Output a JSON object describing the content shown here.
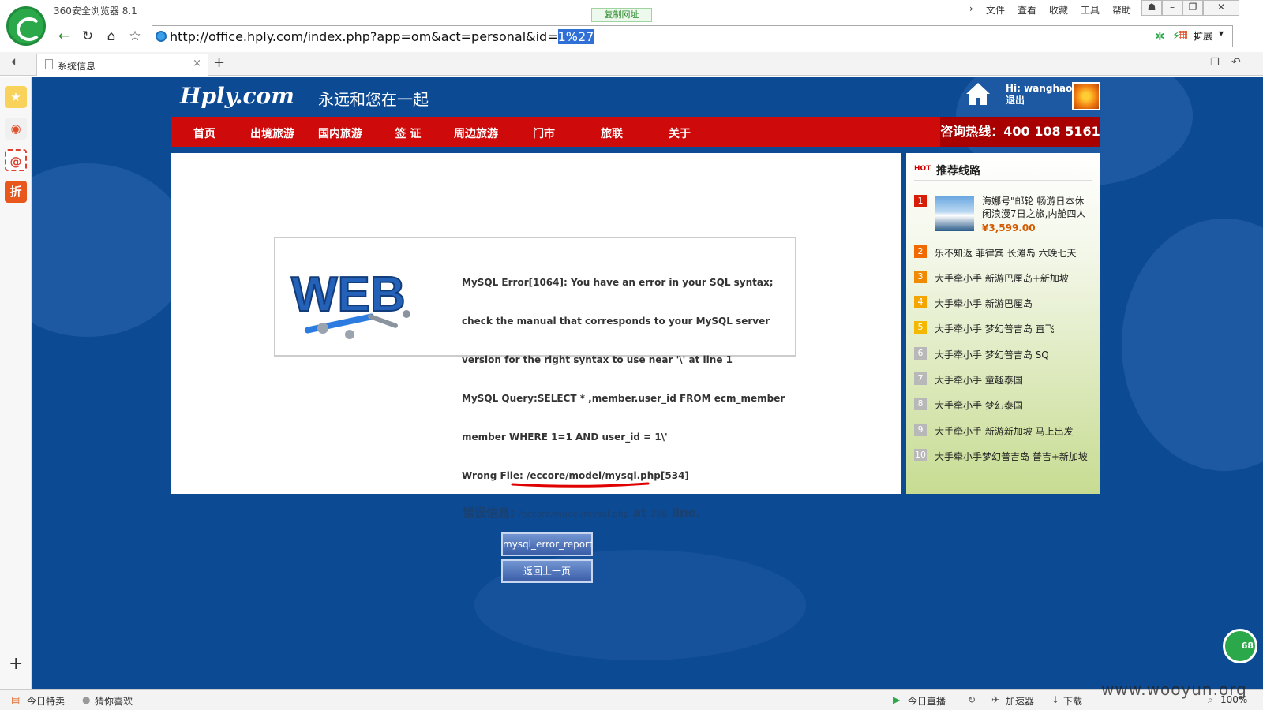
{
  "browser": {
    "title": "360安全浏览器 8.1",
    "copy_url": "复制网址",
    "menus": [
      "文件",
      "查看",
      "收藏",
      "工具",
      "帮助"
    ],
    "url_prefix": "http://office.hply.com/index.php?app=om&act=personal&id=",
    "url_selected": "1%27",
    "extensions_label": "扩展",
    "tab_title": "系统信息",
    "new_tab": "+"
  },
  "sidebar_icons": [
    {
      "name": "favorites-star-icon",
      "glyph": "★",
      "color": "#f0b000"
    },
    {
      "name": "weibo-icon",
      "glyph": "◉",
      "color": "#e0502a"
    },
    {
      "name": "mail-icon",
      "glyph": "@",
      "color": "#ffffff"
    },
    {
      "name": "discount-icon",
      "glyph": "折",
      "color": "#e8571c"
    }
  ],
  "site": {
    "logo": "Hply.com",
    "slogan": "永远和您在一起",
    "greeting": "Hi:  wanghao",
    "logout": "退出",
    "nav": [
      "首页",
      "出境旅游",
      "国内旅游",
      "签 证",
      "周边旅游",
      "门市",
      "旅联",
      "关于"
    ],
    "hotline": "咨询热线：400 108 5161"
  },
  "error": {
    "lines": [
      "MySQL Error[1064]: You have an error in your SQL syntax;",
      "check the manual that corresponds to your MySQL server",
      "version for the right syntax to use near '\\' at line 1",
      "MySQL Query:SELECT * ,member.user_id FROM ecm_member",
      "member WHERE 1=1 AND user_id = 1\\'",
      "Wrong File: /eccore/model/mysql.php[534]"
    ],
    "info_label": "错误信息:",
    "info_path": "/eccore/model/mysql.php",
    "info_at": "at",
    "info_line_no": "286",
    "info_line": "line.",
    "btn_report": "mysql_error_report",
    "btn_back": "返回上一页"
  },
  "recommend": {
    "title": "推荐线路",
    "hot_badge": "HOT",
    "featured_text": "海娜号\"邮轮 畅游日本休闲浪漫7日之旅,内舱四人",
    "featured_price": "¥3,599.00",
    "items": [
      "乐不知返 菲律宾 长滩岛 六晚七天",
      "大手牵小手 新游巴厘岛+新加坡",
      "大手牵小手 新游巴厘岛",
      "大手牵小手 梦幻普吉岛 直飞",
      "大手牵小手 梦幻普吉岛 SQ",
      "大手牵小手 童趣泰国",
      "大手牵小手 梦幻泰国",
      "大手牵小手 新游新加坡 马上出发",
      "大手牵小手梦幻普吉岛 普吉+新加坡"
    ],
    "ranks": [
      "1",
      "2",
      "3",
      "4",
      "5",
      "6",
      "7",
      "8",
      "9",
      "10"
    ]
  },
  "float_badge": "68",
  "statusbar": {
    "left": [
      "今日特卖",
      "猜你喜欢"
    ],
    "right": [
      "今日直播",
      "加速器",
      "下载",
      "100%"
    ]
  },
  "watermark": "www.wooyun.org"
}
